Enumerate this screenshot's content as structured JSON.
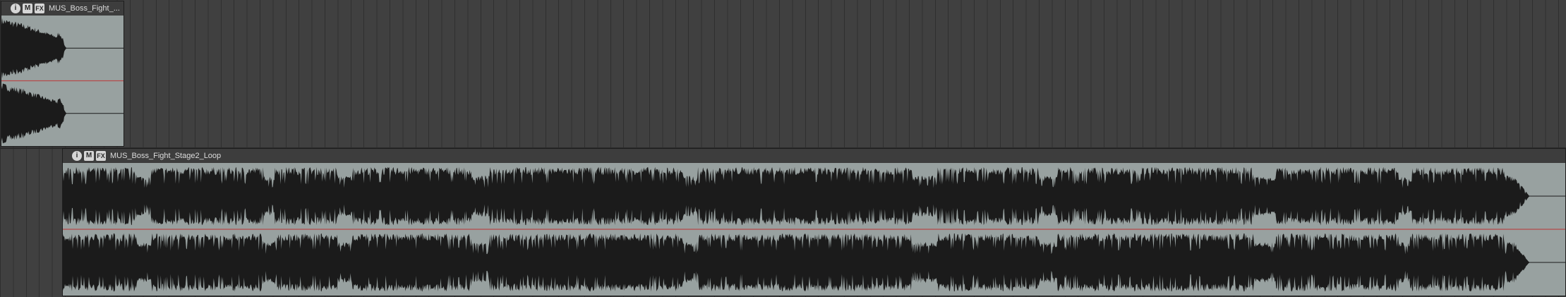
{
  "tracks": [
    {
      "item": {
        "name": "MUS_Boss_Fight_...",
        "buttons": {
          "info": "i",
          "mute": "M",
          "fx": "FX"
        }
      }
    },
    {
      "item": {
        "name": "MUS_Boss_Fight_Stage2_Loop",
        "buttons": {
          "info": "i",
          "mute": "M",
          "fx": "FX"
        }
      }
    }
  ],
  "colors": {
    "background": "#404040",
    "gridline": "#2f2f2f",
    "item_body": "#98a1a0",
    "item_header": "#3d3d3d",
    "waveform": "#1b1b1b",
    "center_line": "#b44a4a"
  },
  "icons": {
    "info": "info-circle-icon",
    "mute": "mute-icon",
    "fx": "fx-icon"
  }
}
